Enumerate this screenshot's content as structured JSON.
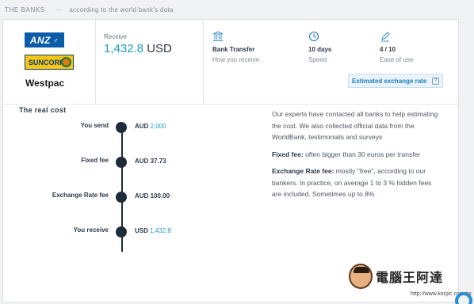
{
  "header": {
    "title": "THE BANKS",
    "subtitle": "according to the world bank's data"
  },
  "banks": {
    "logos": [
      "ANZ",
      "SUNCORP",
      "Westpac"
    ]
  },
  "receive": {
    "label": "Receive",
    "amount": "1,432.8",
    "currency": "USD"
  },
  "stats": {
    "transfer": {
      "icon": "bank-icon",
      "value": "Bank Transfer",
      "label": "How you receive"
    },
    "speed": {
      "icon": "clock-icon",
      "value": "10 days",
      "label": "Speed"
    },
    "ease": {
      "icon": "pen-icon",
      "value": "4 / 10",
      "label": "Ease of use"
    }
  },
  "estimated_rate": {
    "label": "Estimated exchange rate",
    "help": "?"
  },
  "real_cost": {
    "title": "The real cost",
    "rows": [
      {
        "label": "You send",
        "currency": "AUD",
        "amount": "2,000"
      },
      {
        "label": "Fixed fee",
        "currency": "AUD",
        "amount": "37.73"
      },
      {
        "label": "Exchange Rate fee",
        "currency": "AUD",
        "amount": "100.00"
      },
      {
        "label": "You receive",
        "currency": "USD",
        "amount": "1,432.8"
      }
    ]
  },
  "explanation": {
    "intro": "Our experts have contacted all banks to help estimating the cost. We also collected official data from the WorldBank, testimonials and surveys",
    "fixed_fee_title": "Fixed fee:",
    "fixed_fee_text": "often bigger than 30 euros per transfer",
    "exchange_fee_title": "Exchange Rate fee:",
    "exchange_fee_text": "mostly \"free\", according to our bankers. In practice, on average 1 to 3 % hidden fees are included. Sometimes up to 8%"
  },
  "watermark": {
    "text": "電腦王阿達",
    "url": "http://www.kocpc.com.tw"
  },
  "colors": {
    "accent": "#1e9ec9",
    "dark": "#1d2b3a",
    "button_bg": "#eaf3fb"
  }
}
